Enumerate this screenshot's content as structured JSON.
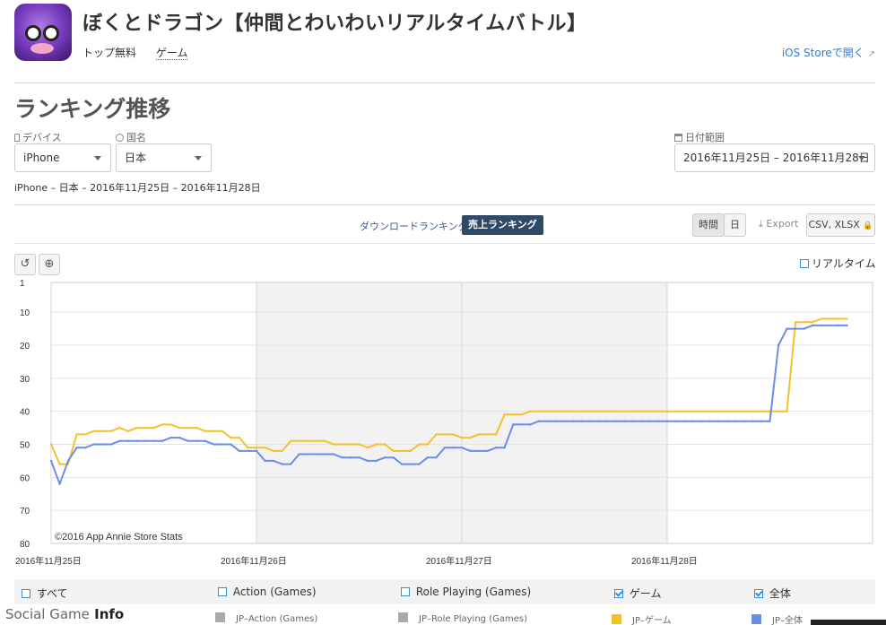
{
  "app": {
    "title": "ぼくとドラゴン【仲間とわいわいリアルタイムバトル】",
    "price": "トップ無料",
    "category": "ゲーム",
    "store_link": "iOS Storeで開く"
  },
  "section_title": "ランキング推移",
  "filters": {
    "device_label": "デバイス",
    "device_value": "iPhone",
    "country_label": "国名",
    "country_value": "日本",
    "date_label": "日付範囲",
    "date_value": "2016年11月25日 – 2016年11月28日"
  },
  "summary": "iPhone – 日本 – 2016年11月25日 – 2016年11月28日",
  "tabs": {
    "downloads": "ダウンロードランキング",
    "sales": "売上ランキング"
  },
  "granularity": {
    "hour": "時間",
    "day": "日"
  },
  "export": {
    "label": "Export",
    "format": "CSV, XLSX"
  },
  "toolbar": {
    "reset_icon": "reset-icon",
    "zoom_icon": "zoom-icon"
  },
  "realtime_label": "リアルタイム",
  "legend": {
    "all": "すべて",
    "action": "Action (Games)",
    "role": "Role Playing (Games)",
    "game": "ゲーム",
    "overall": "全体"
  },
  "series_keys": {
    "action": "JP–Action (Games)",
    "role": "JP–Role Playing (Games)",
    "game": "JP–ゲーム",
    "overall": "JP–全体"
  },
  "watermark": {
    "part1": "Social Game",
    "part2": "Info"
  },
  "colors": {
    "game": "#f5c02a",
    "overall": "#6a8ee8",
    "key_gray": "#aaaaaa",
    "accent": "#2e4a66",
    "link": "#3a7bc8"
  },
  "chart_data": {
    "type": "line",
    "credit": "©2016 App Annie Store Stats",
    "y_reversed": true,
    "ylim": [
      1,
      80
    ],
    "yticks": [
      1,
      10,
      20,
      30,
      40,
      50,
      60,
      70,
      80
    ],
    "x_range": [
      0,
      4
    ],
    "xtick_positions": [
      0,
      1,
      2,
      3
    ],
    "xtick_labels": [
      "2016年11月25日",
      "2016年11月26日",
      "2016年11月27日",
      "2016年11月28日"
    ],
    "shaded_ranges": [
      [
        1,
        2
      ],
      [
        2,
        3
      ]
    ],
    "x": [
      0,
      0.042,
      0.083,
      0.125,
      0.167,
      0.208,
      0.25,
      0.292,
      0.333,
      0.375,
      0.417,
      0.458,
      0.5,
      0.542,
      0.583,
      0.625,
      0.667,
      0.708,
      0.75,
      0.792,
      0.833,
      0.875,
      0.917,
      0.958,
      1.0,
      1.042,
      1.083,
      1.125,
      1.167,
      1.208,
      1.25,
      1.292,
      1.333,
      1.375,
      1.417,
      1.458,
      1.5,
      1.542,
      1.583,
      1.625,
      1.667,
      1.708,
      1.75,
      1.792,
      1.833,
      1.875,
      1.917,
      1.958,
      2.0,
      2.042,
      2.083,
      2.125,
      2.167,
      2.208,
      2.25,
      2.292,
      2.333,
      2.375,
      2.417,
      2.458,
      2.5,
      2.542,
      2.583,
      2.625,
      2.667,
      2.708,
      2.75,
      2.792,
      2.833,
      2.875,
      2.917,
      2.958,
      3.0,
      3.042,
      3.083,
      3.125,
      3.167,
      3.208,
      3.25,
      3.292,
      3.333,
      3.375,
      3.417,
      3.458,
      3.5,
      3.542,
      3.583,
      3.625,
      3.667,
      3.708,
      3.75,
      3.792,
      3.833,
      3.875
    ],
    "series": [
      {
        "name": "JP–ゲーム",
        "color": "#f5c02a",
        "values": [
          50,
          56,
          56,
          47,
          47,
          46,
          46,
          46,
          45,
          46,
          45,
          45,
          45,
          44,
          44,
          45,
          45,
          45,
          46,
          46,
          46,
          48,
          48,
          51,
          51,
          51,
          52,
          52,
          49,
          49,
          49,
          49,
          49,
          50,
          50,
          50,
          50,
          51,
          50,
          50,
          52,
          52,
          52,
          50,
          50,
          47,
          47,
          47,
          48,
          48,
          47,
          47,
          47,
          41,
          41,
          41,
          40,
          40,
          40,
          40,
          40,
          40,
          40,
          40,
          40,
          40,
          40,
          40,
          40,
          40,
          40,
          40,
          40,
          40,
          40,
          40,
          40,
          40,
          40,
          40,
          40,
          40,
          40,
          40,
          40,
          40,
          40,
          13,
          13,
          13,
          12,
          12,
          12,
          12
        ]
      },
      {
        "name": "JP–全体",
        "color": "#6a8ee8",
        "values": [
          55,
          62,
          55,
          51,
          51,
          50,
          50,
          50,
          49,
          49,
          49,
          49,
          49,
          49,
          48,
          48,
          49,
          49,
          49,
          50,
          50,
          50,
          52,
          52,
          52,
          55,
          55,
          56,
          56,
          53,
          53,
          53,
          53,
          53,
          54,
          54,
          54,
          55,
          55,
          54,
          54,
          56,
          56,
          56,
          54,
          54,
          51,
          51,
          51,
          52,
          52,
          52,
          51,
          51,
          44,
          44,
          44,
          43,
          43,
          43,
          43,
          43,
          43,
          43,
          43,
          43,
          43,
          43,
          43,
          43,
          43,
          43,
          43,
          43,
          43,
          43,
          43,
          43,
          43,
          43,
          43,
          43,
          43,
          43,
          43,
          20,
          15,
          15,
          15,
          14,
          14,
          14,
          14,
          14
        ]
      }
    ]
  }
}
